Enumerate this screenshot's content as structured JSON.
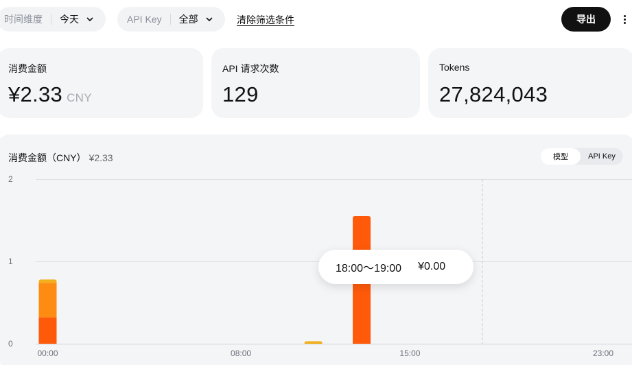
{
  "filters": {
    "time": {
      "label": "时间维度",
      "value": "今天"
    },
    "api_key": {
      "label": "API Key",
      "value": "全部"
    },
    "clear_label": "清除筛选条件"
  },
  "actions": {
    "export_label": "导出"
  },
  "stats": {
    "cost": {
      "title": "消费金额",
      "value": "¥2.33",
      "unit": "CNY"
    },
    "requests": {
      "title": "API 请求次数",
      "value": "129"
    },
    "tokens": {
      "title": "Tokens",
      "value": "27,824,043"
    }
  },
  "chart_panel": {
    "title": "消费金额（CNY）",
    "total": "¥2.33",
    "toggle": {
      "options": [
        "模型",
        "API Key"
      ],
      "selected": "模型"
    }
  },
  "tooltip": {
    "time": "18:00～19:00",
    "value": "¥0.00"
  },
  "colors": {
    "accent": "#ff5a0a",
    "secondary": "#ff8c12",
    "tertiary": "#f2b01e",
    "button": "#111111"
  },
  "chart_data": {
    "type": "bar",
    "stacked": true,
    "x_tick_labels": [
      "00:00",
      "08:00",
      "15:00",
      "23:00"
    ],
    "x_tick_hours": [
      0,
      8,
      15,
      23
    ],
    "ylim": [
      0,
      2
    ],
    "y_ticks": [
      0,
      1,
      2
    ],
    "hover_hour": 18,
    "bars": [
      {
        "hour": 0,
        "segments": [
          {
            "value": 0.32,
            "color": "#ff5a0a"
          },
          {
            "value": 0.42,
            "color": "#ff8c12"
          },
          {
            "value": 0.04,
            "color": "#f2b01e"
          }
        ]
      },
      {
        "hour": 11,
        "segments": [
          {
            "value": 0.03,
            "color": "#f2b01e"
          }
        ]
      },
      {
        "hour": 13,
        "segments": [
          {
            "value": 1.55,
            "color": "#ff5a0a"
          }
        ]
      }
    ]
  }
}
